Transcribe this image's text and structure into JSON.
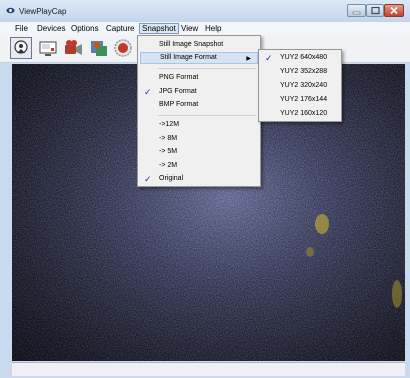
{
  "window": {
    "title": "ViewPlayCap"
  },
  "menubar": {
    "items": [
      "File",
      "Devices",
      "Options",
      "Capture",
      "Snapshot",
      "View",
      "Help"
    ],
    "active": "Snapshot"
  },
  "toolbar": {
    "buttons": [
      "snapshot-icon",
      "monitor-icon",
      "record-icon",
      "settings-icon",
      "stop-icon"
    ]
  },
  "snapshot_menu": {
    "items": [
      {
        "label": "Still Image Snapshot",
        "checked": false,
        "submenu": false
      },
      {
        "label": "Still Image Format",
        "checked": false,
        "submenu": true,
        "highlighted": true
      },
      {
        "label": "PNG Format",
        "checked": false
      },
      {
        "label": "JPG Format",
        "checked": true
      },
      {
        "label": "BMP Format",
        "checked": false
      },
      {
        "label": "->12M",
        "checked": false
      },
      {
        "label": "-> 8M",
        "checked": false
      },
      {
        "label": "-> 5M",
        "checked": false
      },
      {
        "label": "-> 2M",
        "checked": false
      },
      {
        "label": "Original",
        "checked": true
      }
    ]
  },
  "format_submenu": {
    "items": [
      {
        "label": "YUY2 640x480",
        "checked": true
      },
      {
        "label": "YUY2 352x288",
        "checked": false
      },
      {
        "label": "YUY2 320x240",
        "checked": false
      },
      {
        "label": "YUY2 176x144",
        "checked": false
      },
      {
        "label": "YUY2 160x120",
        "checked": false
      }
    ]
  },
  "glyphs": {
    "check": "✓",
    "arrow": "▶"
  },
  "colors": {
    "menu_highlight": "#d5e3f5",
    "check": "#1b3b87",
    "video_dark": "#23263e"
  }
}
